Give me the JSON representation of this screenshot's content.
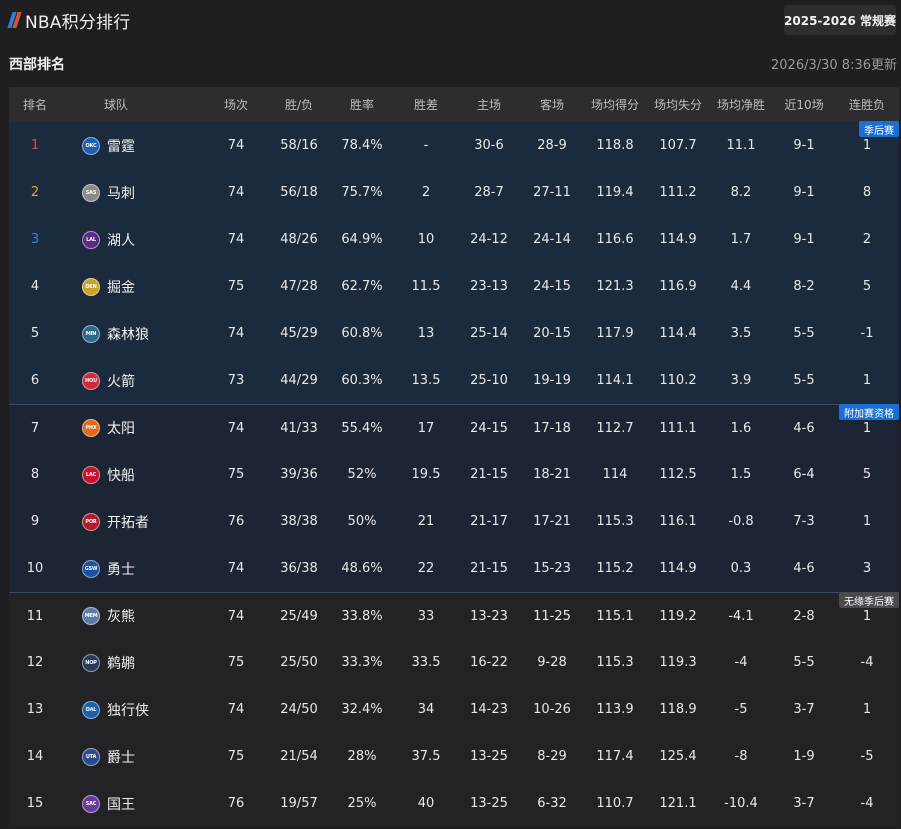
{
  "header": {
    "title": "NBA积分排行",
    "season_button": "2025-2026 常规赛"
  },
  "section": {
    "title": "西部排名",
    "updated": "2026/3/30 8:36更新"
  },
  "columns": [
    "排名",
    "球队",
    "场次",
    "胜/负",
    "胜率",
    "胜差",
    "主场",
    "客场",
    "场均得分",
    "场均失分",
    "场均净胜",
    "近10场",
    "连胜负"
  ],
  "zones": {
    "playoff": {
      "label": "季后赛",
      "color": "#1a6fd6"
    },
    "playin": {
      "label": "附加赛资格",
      "color": "#1a6fd6"
    },
    "out": {
      "label": "无缘季后赛",
      "color": "#4a4a4d"
    }
  },
  "rank_colors": {
    "1": "#e0485a",
    "2": "#e8a23a",
    "3": "#2f86e8"
  },
  "teams": [
    {
      "rank": "1",
      "name": "雷霆",
      "abbr": "OKC",
      "icon_color": "#1d5fb3",
      "games": "74",
      "wl": "58/16",
      "pct": "78.4%",
      "gb": "-",
      "home": "30-6",
      "away": "28-9",
      "ppg": "118.8",
      "opp": "107.7",
      "diff": "11.1",
      "last10": "9-1",
      "streak": "1"
    },
    {
      "rank": "2",
      "name": "马刺",
      "abbr": "SAS",
      "icon_color": "#8a8a8a",
      "games": "74",
      "wl": "56/18",
      "pct": "75.7%",
      "gb": "2",
      "home": "28-7",
      "away": "27-11",
      "ppg": "119.4",
      "opp": "111.2",
      "diff": "8.2",
      "last10": "9-1",
      "streak": "8"
    },
    {
      "rank": "3",
      "name": "湖人",
      "abbr": "LAL",
      "icon_color": "#5b2a86",
      "games": "74",
      "wl": "48/26",
      "pct": "64.9%",
      "gb": "10",
      "home": "24-12",
      "away": "24-14",
      "ppg": "116.6",
      "opp": "114.9",
      "diff": "1.7",
      "last10": "9-1",
      "streak": "2"
    },
    {
      "rank": "4",
      "name": "掘金",
      "abbr": "DEN",
      "icon_color": "#c8a42a",
      "games": "75",
      "wl": "47/28",
      "pct": "62.7%",
      "gb": "11.5",
      "home": "23-13",
      "away": "24-15",
      "ppg": "121.3",
      "opp": "116.9",
      "diff": "4.4",
      "last10": "8-2",
      "streak": "5"
    },
    {
      "rank": "5",
      "name": "森林狼",
      "abbr": "MIN",
      "icon_color": "#2d6a8a",
      "games": "74",
      "wl": "45/29",
      "pct": "60.8%",
      "gb": "13",
      "home": "25-14",
      "away": "20-15",
      "ppg": "117.9",
      "opp": "114.4",
      "diff": "3.5",
      "last10": "5-5",
      "streak": "-1"
    },
    {
      "rank": "6",
      "name": "火箭",
      "abbr": "HOU",
      "icon_color": "#d02a3a",
      "games": "73",
      "wl": "44/29",
      "pct": "60.3%",
      "gb": "13.5",
      "home": "25-10",
      "away": "19-19",
      "ppg": "114.1",
      "opp": "110.2",
      "diff": "3.9",
      "last10": "5-5",
      "streak": "1"
    },
    {
      "rank": "7",
      "name": "太阳",
      "abbr": "PHX",
      "icon_color": "#e06a1c",
      "games": "74",
      "wl": "41/33",
      "pct": "55.4%",
      "gb": "17",
      "home": "24-15",
      "away": "17-18",
      "ppg": "112.7",
      "opp": "111.1",
      "diff": "1.6",
      "last10": "4-6",
      "streak": "1"
    },
    {
      "rank": "8",
      "name": "快船",
      "abbr": "LAC",
      "icon_color": "#c8102e",
      "games": "75",
      "wl": "39/36",
      "pct": "52%",
      "gb": "19.5",
      "home": "21-15",
      "away": "18-21",
      "ppg": "114",
      "opp": "112.5",
      "diff": "1.5",
      "last10": "6-4",
      "streak": "5"
    },
    {
      "rank": "9",
      "name": "开拓者",
      "abbr": "POR",
      "icon_color": "#b01c2a",
      "games": "76",
      "wl": "38/38",
      "pct": "50%",
      "gb": "21",
      "home": "21-17",
      "away": "17-21",
      "ppg": "115.3",
      "opp": "116.1",
      "diff": "-0.8",
      "last10": "7-3",
      "streak": "1"
    },
    {
      "rank": "10",
      "name": "勇士",
      "abbr": "GSW",
      "icon_color": "#1d4fa3",
      "games": "74",
      "wl": "36/38",
      "pct": "48.6%",
      "gb": "22",
      "home": "21-15",
      "away": "15-23",
      "ppg": "115.2",
      "opp": "114.9",
      "diff": "0.3",
      "last10": "4-6",
      "streak": "3"
    },
    {
      "rank": "11",
      "name": "灰熊",
      "abbr": "MEM",
      "icon_color": "#5a7aa8",
      "games": "74",
      "wl": "25/49",
      "pct": "33.8%",
      "gb": "33",
      "home": "13-23",
      "away": "11-25",
      "ppg": "115.1",
      "opp": "119.2",
      "diff": "-4.1",
      "last10": "2-8",
      "streak": "1"
    },
    {
      "rank": "12",
      "name": "鹈鹕",
      "abbr": "NOP",
      "icon_color": "#2a3a5a",
      "games": "75",
      "wl": "25/50",
      "pct": "33.3%",
      "gb": "33.5",
      "home": "16-22",
      "away": "9-28",
      "ppg": "115.3",
      "opp": "119.3",
      "diff": "-4",
      "last10": "5-5",
      "streak": "-4"
    },
    {
      "rank": "13",
      "name": "独行侠",
      "abbr": "DAL",
      "icon_color": "#1a5fb0",
      "games": "74",
      "wl": "24/50",
      "pct": "32.4%",
      "gb": "34",
      "home": "14-23",
      "away": "10-26",
      "ppg": "113.9",
      "opp": "118.9",
      "diff": "-5",
      "last10": "3-7",
      "streak": "1"
    },
    {
      "rank": "14",
      "name": "爵士",
      "abbr": "UTA",
      "icon_color": "#2a4a8a",
      "games": "75",
      "wl": "21/54",
      "pct": "28%",
      "gb": "37.5",
      "home": "13-25",
      "away": "8-29",
      "ppg": "117.4",
      "opp": "125.4",
      "diff": "-8",
      "last10": "1-9",
      "streak": "-5"
    },
    {
      "rank": "15",
      "name": "国王",
      "abbr": "SAC",
      "icon_color": "#6a3a9a",
      "games": "76",
      "wl": "19/57",
      "pct": "25%",
      "gb": "40",
      "home": "13-25",
      "away": "6-32",
      "ppg": "110.7",
      "opp": "121.1",
      "diff": "-10.4",
      "last10": "3-7",
      "streak": "-4"
    }
  ]
}
